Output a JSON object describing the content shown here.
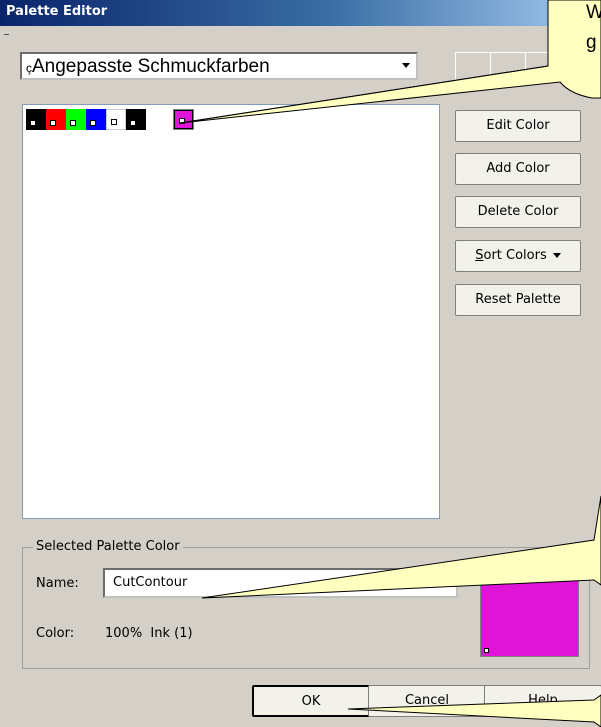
{
  "window": {
    "title": "Palette Editor"
  },
  "palette": {
    "selected": "Angepasste Schmuckfarben"
  },
  "swatches": [
    {
      "color": "#000000"
    },
    {
      "color": "#ff0000"
    },
    {
      "color": "#00ff00"
    },
    {
      "color": "#0000ff"
    },
    {
      "color": "#ffffff"
    },
    {
      "color": "#000000"
    },
    {
      "color": "#e013d8"
    }
  ],
  "actions": {
    "edit_color": "Edit Color",
    "add_color": "Add Color",
    "delete_color": "Delete Color",
    "sort_colors_accel": "S",
    "sort_colors_rest": "ort Colors",
    "reset_palette": "Reset Palette"
  },
  "selected_color": {
    "legend": "Selected Palette Color",
    "name_label": "Name:",
    "name_value": "CutContour",
    "color_label": "Color:",
    "color_value": "100%  Ink (1)",
    "preview_color": "#e013d8"
  },
  "footer": {
    "ok": "OK",
    "cancel": "Cancel",
    "help": "Help"
  },
  "callout": {
    "line1": "W",
    "line2": "g"
  },
  "combo_prefix": "ç"
}
